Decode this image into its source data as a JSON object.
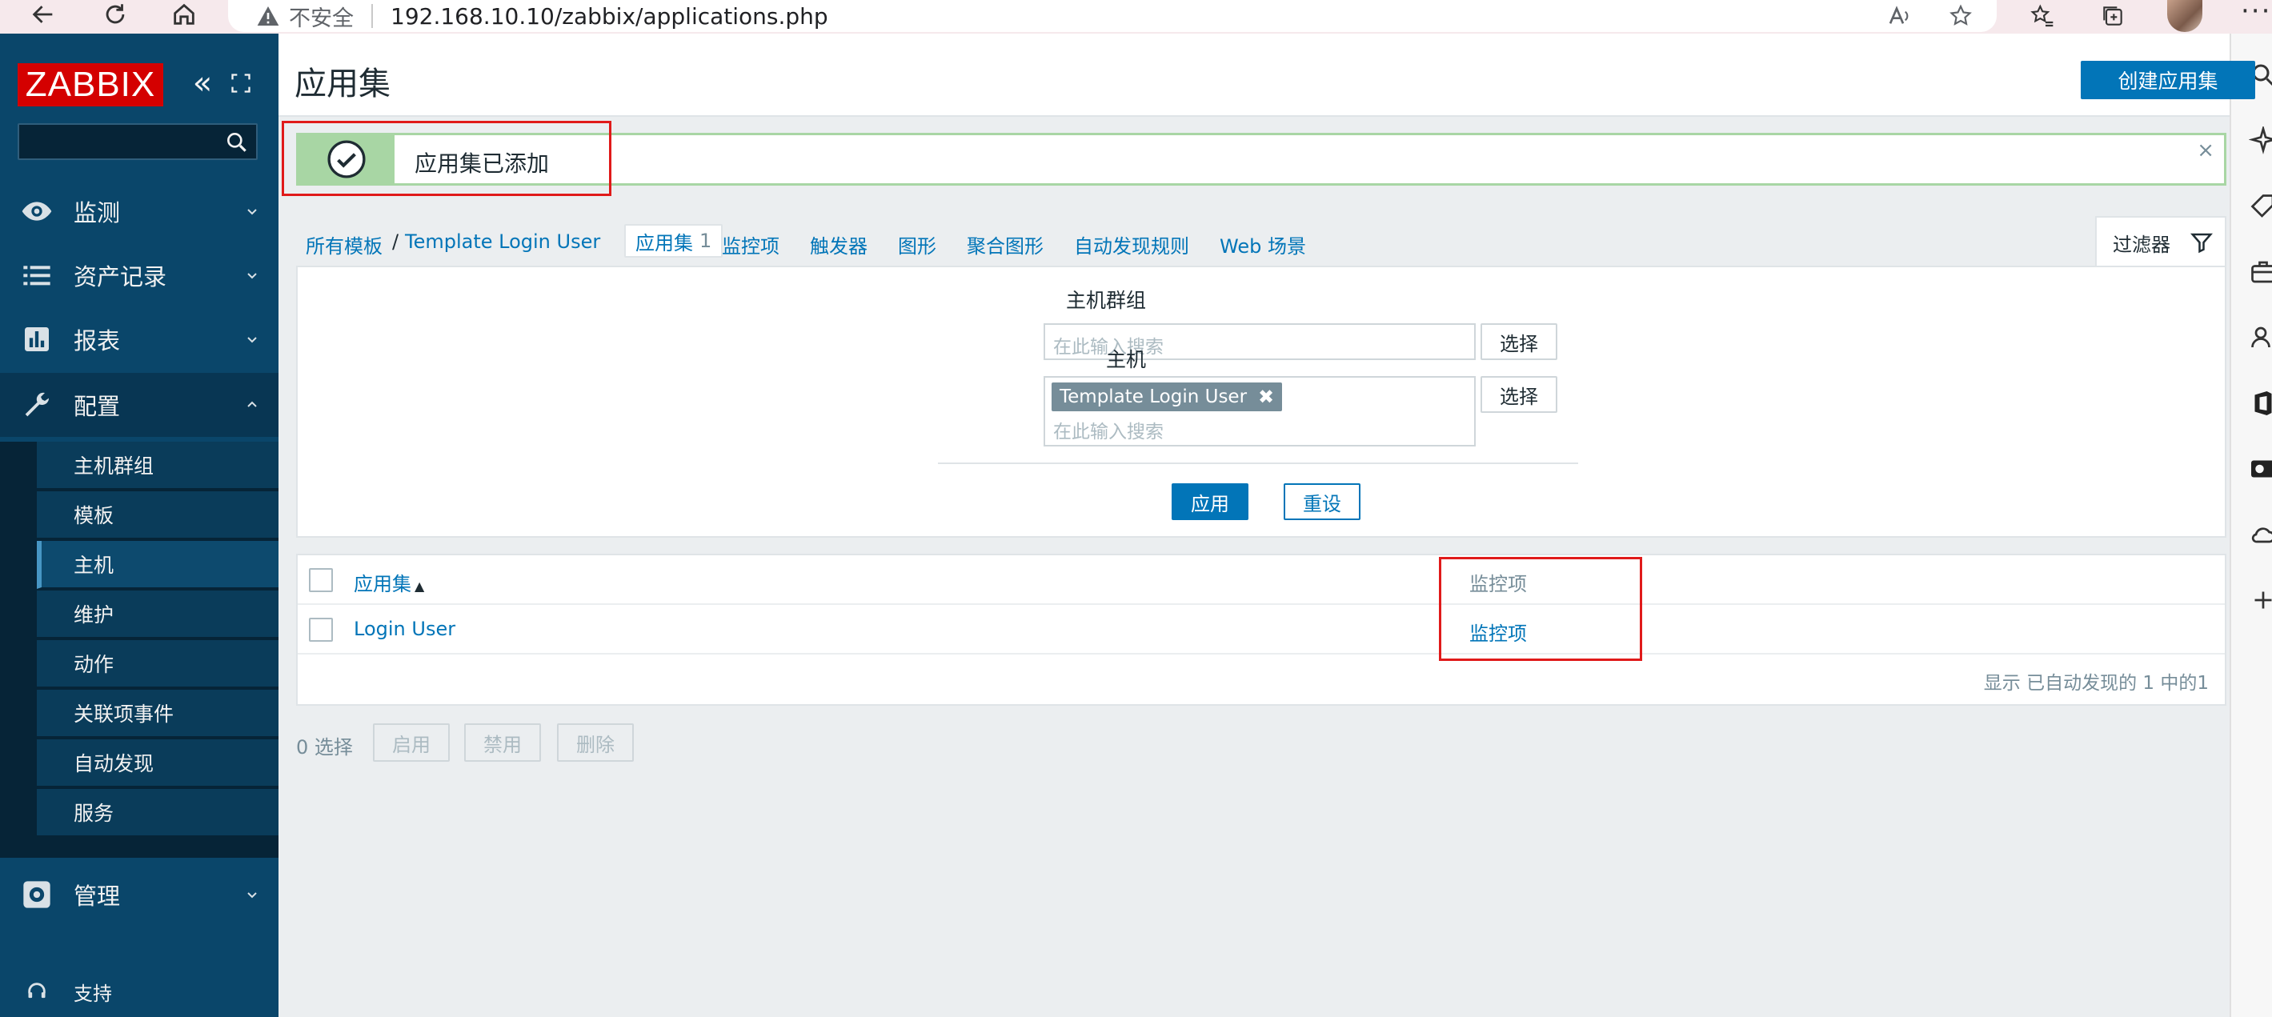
{
  "browser": {
    "insecure_label": "不安全",
    "url": "192.168.10.10/zabbix/applications.php"
  },
  "sidebar": {
    "logo": "ZABBIX",
    "collapse_glyph": "«",
    "menu": [
      {
        "label": "监测",
        "icon": "eye-icon"
      },
      {
        "label": "资产记录",
        "icon": "list-icon"
      },
      {
        "label": "报表",
        "icon": "bar-chart-icon"
      },
      {
        "label": "配置",
        "icon": "wrench-icon"
      },
      {
        "label": "管理",
        "icon": "gear-icon"
      }
    ],
    "config_submenu": [
      "主机群组",
      "模板",
      "主机",
      "维护",
      "动作",
      "关联项事件",
      "自动发现",
      "服务"
    ],
    "selected_submenu": "主机",
    "support": "支持"
  },
  "header": {
    "title": "应用集",
    "create_button": "创建应用集"
  },
  "message": {
    "text": "应用集已添加",
    "close_glyph": "×"
  },
  "breadcrumb": {
    "all_templates": "所有模板",
    "separator": "/",
    "template": "Template Login User",
    "tabs": [
      {
        "label": "应用集",
        "count": "1"
      },
      {
        "label": "监控项"
      },
      {
        "label": "触发器"
      },
      {
        "label": "图形"
      },
      {
        "label": "聚合图形"
      },
      {
        "label": "自动发现规则"
      },
      {
        "label": "Web 场景"
      }
    ]
  },
  "filter": {
    "tab_label": "过滤器",
    "host_group_label": "主机群组",
    "host_group_placeholder": "在此输入搜索",
    "host_label": "主机",
    "host_chip": "Template Login User",
    "chip_remove": "✖",
    "host_placeholder": "在此输入搜索",
    "select_button": "选择",
    "apply_button": "应用",
    "reset_button": "重设"
  },
  "table": {
    "columns": [
      "应用集",
      "监控项"
    ],
    "sort_glyph": "▲",
    "rows": [
      {
        "name": "Login User",
        "items": "监控项"
      }
    ],
    "footer": "显示 已自动发现的 1 中的1"
  },
  "actions": {
    "selected": "0 选择",
    "buttons": [
      "启用",
      "禁用",
      "删除"
    ]
  },
  "colors": {
    "sidebar_bg": "#0a466a",
    "link": "#0275b8",
    "logo_red": "#d40000",
    "success_green": "#a8d6a4",
    "highlight_red": "#e01a1a"
  }
}
